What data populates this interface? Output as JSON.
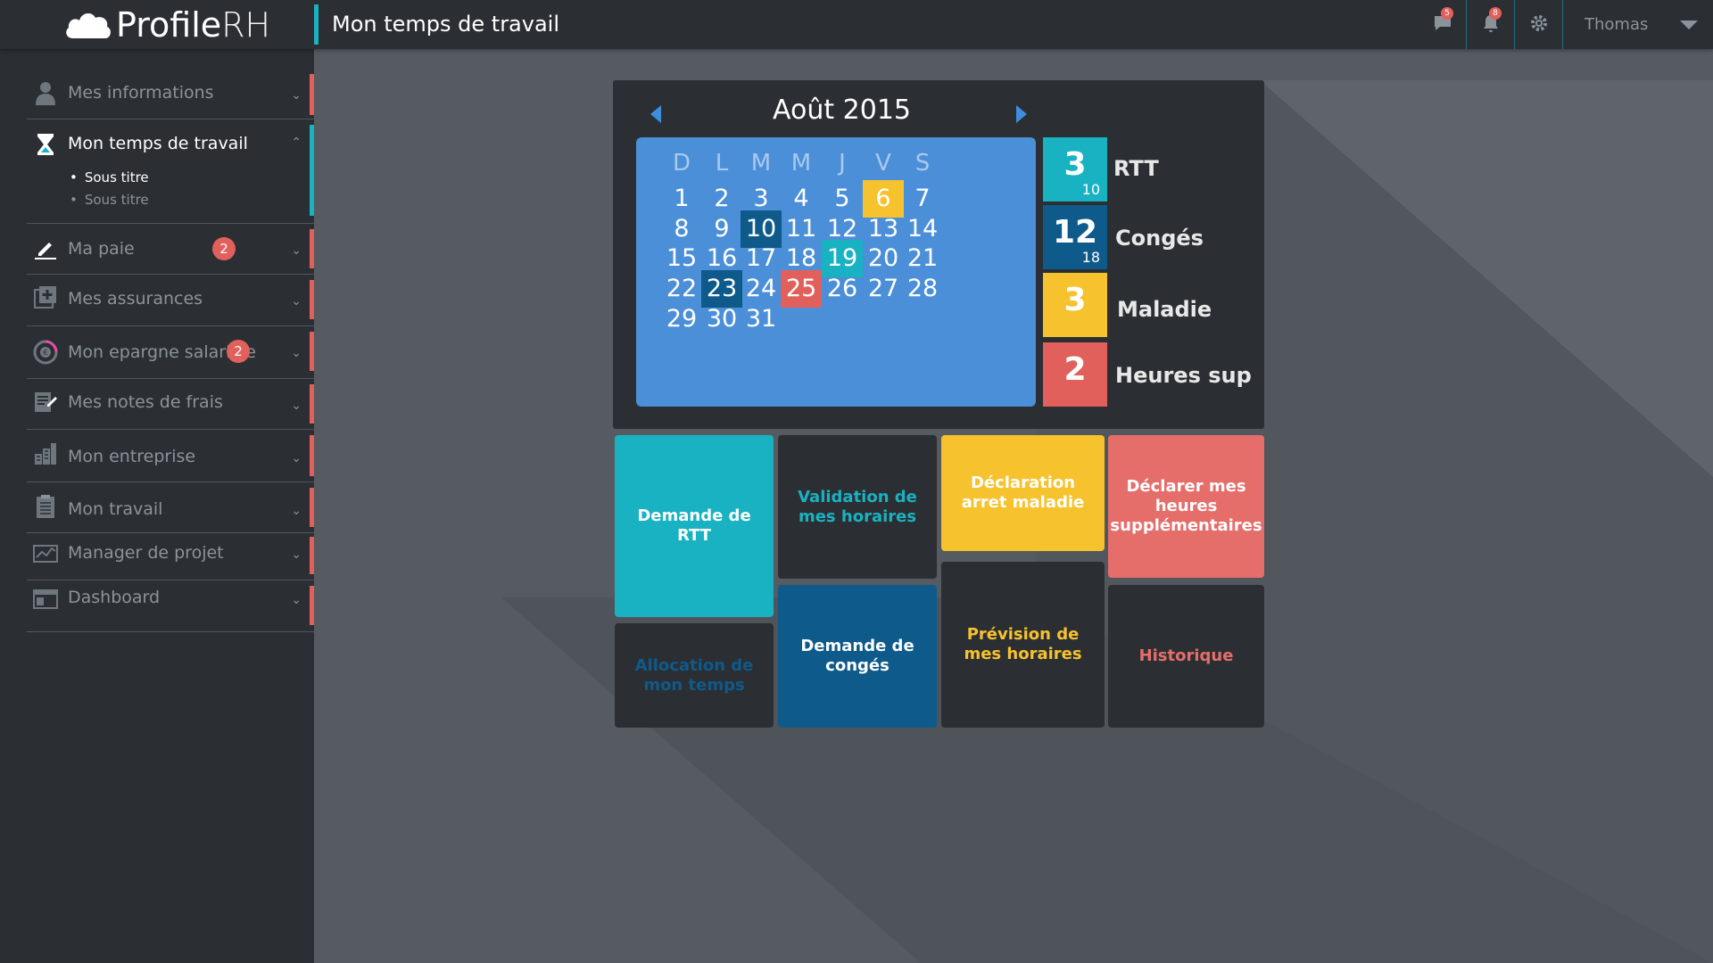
{
  "app": {
    "logo_text": "Profile",
    "logo_suffix": "RH",
    "page_title": "Mon temps de travail"
  },
  "topbar": {
    "messages_count": "5",
    "notifications_count": "8",
    "user_name": "Thomas"
  },
  "sidebar": {
    "items": [
      {
        "label": "Mes informations",
        "icon": "user-icon"
      },
      {
        "label": "Mon temps de travail",
        "icon": "hourglass-icon",
        "subitems": [
          "Sous titre",
          "Sous titre"
        ]
      },
      {
        "label": "Ma paie",
        "icon": "pen-icon",
        "badge": "2"
      },
      {
        "label": "Mes assurances",
        "icon": "plus-box-icon"
      },
      {
        "label": "Mon epargne salariale",
        "icon": "savings-icon",
        "badge": "2"
      },
      {
        "label": "Mes notes de frais",
        "icon": "notes-icon"
      },
      {
        "label": "Mon entreprise",
        "icon": "building-icon"
      },
      {
        "label": "Mon travail",
        "icon": "clipboard-icon"
      },
      {
        "label": "Manager de projet",
        "icon": "chart-icon"
      },
      {
        "label": "Dashboard",
        "icon": "dashboard-icon"
      }
    ]
  },
  "calendar": {
    "month_title": "Août 2015",
    "weekdays": [
      "D",
      "L",
      "M",
      "M",
      "J",
      "V",
      "S"
    ],
    "weeks": [
      [
        "1",
        "2",
        "3",
        "4",
        "5",
        "6",
        "7"
      ],
      [
        "8",
        "9",
        "10",
        "11",
        "12",
        "13",
        "14"
      ],
      [
        "15",
        "16",
        "17",
        "18",
        "19",
        "20",
        "21"
      ],
      [
        "22",
        "23",
        "24",
        "25",
        "26",
        "27",
        "28"
      ],
      [
        "29",
        "30",
        "31"
      ]
    ],
    "colors": {
      "yellow": "#f6c22e",
      "navy": "#0e5a8a",
      "teal": "#19b2c2",
      "red": "#e2605c"
    }
  },
  "stats": [
    {
      "value": "3",
      "sub": "10",
      "label": "RTT",
      "color": "#19b2c2"
    },
    {
      "value": "12",
      "sub": "18",
      "label": "Congés",
      "color": "#0e5a8a"
    },
    {
      "value": "3",
      "sub": "",
      "label": "Maladie",
      "color": "#f6c22e"
    },
    {
      "value": "2",
      "sub": "",
      "label": "Heures sup",
      "color": "#e2605c"
    }
  ],
  "tiles": {
    "demande_rtt": "Demande de RTT",
    "validation_horaires": "Validation de mes horaires",
    "declaration_arret": "Déclaration arret maladie",
    "heures_sup": "Déclarer mes heures supplémentaires",
    "allocation_temps": "Allocation de mon temps",
    "demande_conges": "Demande de congés",
    "prevision_horaires": "Prévision de mes horaires",
    "historique": "Historique"
  }
}
